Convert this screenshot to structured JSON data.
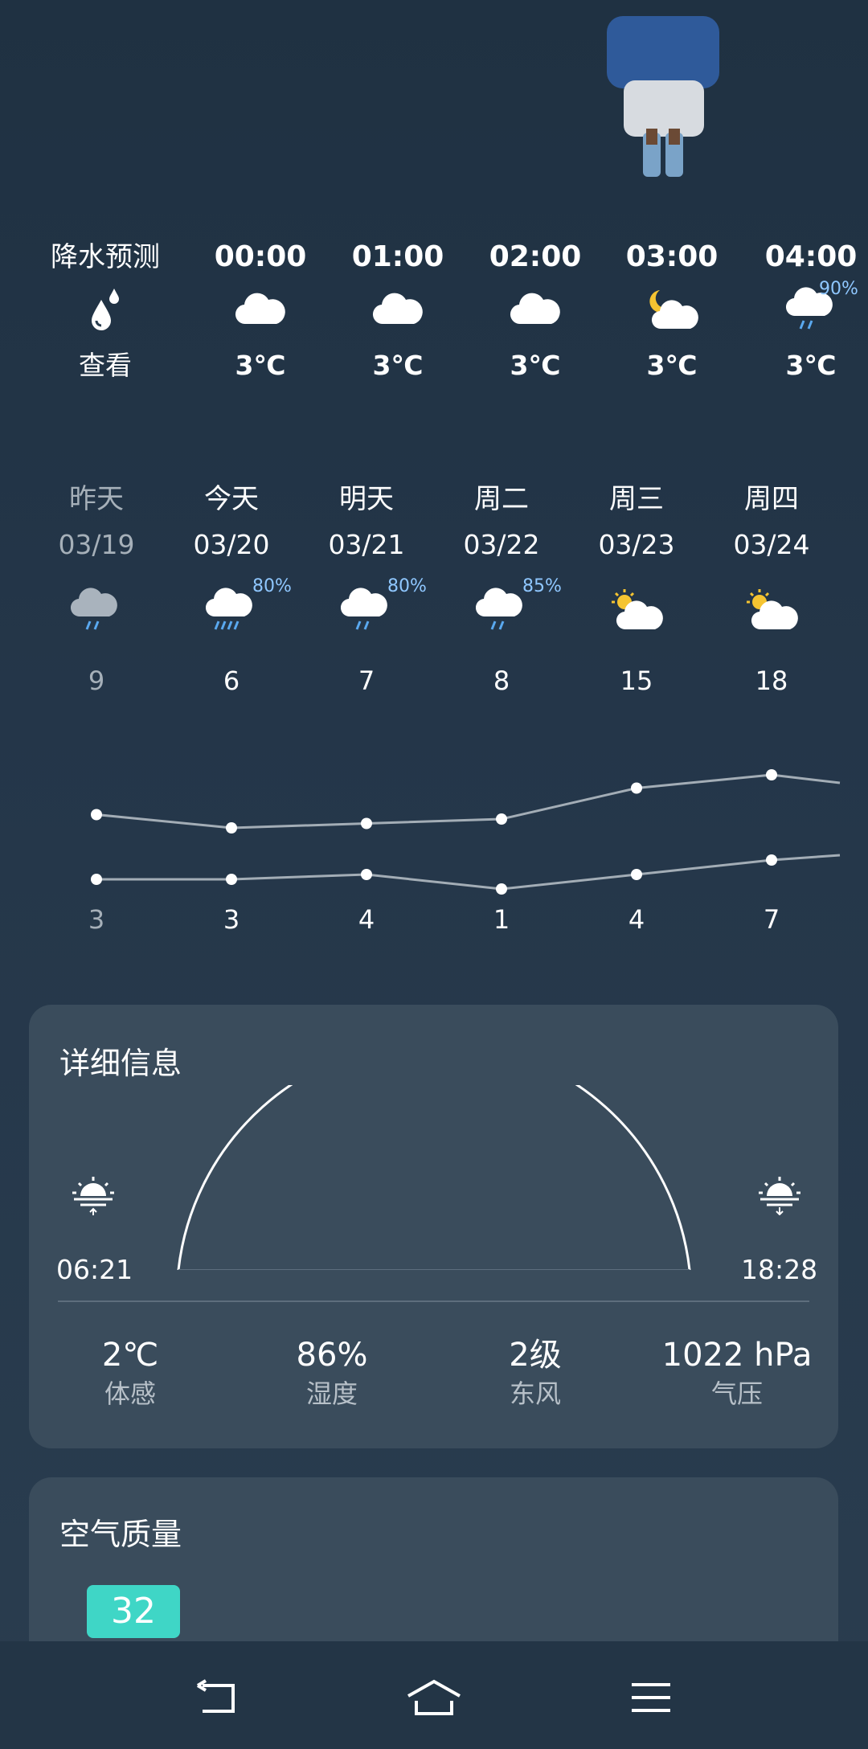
{
  "hourly": {
    "label": "降水预测",
    "check": "查看",
    "items": [
      {
        "time": "00:00",
        "temp": "3℃",
        "icon": "cloudy-icon",
        "pct": ""
      },
      {
        "time": "01:00",
        "temp": "3℃",
        "icon": "cloudy-icon",
        "pct": ""
      },
      {
        "time": "02:00",
        "temp": "3℃",
        "icon": "cloudy-icon",
        "pct": ""
      },
      {
        "time": "03:00",
        "temp": "3℃",
        "icon": "cloudy-night-icon",
        "pct": ""
      },
      {
        "time": "04:00",
        "temp": "3℃",
        "icon": "light-rain-icon",
        "pct": "90%"
      }
    ]
  },
  "daily": [
    {
      "name": "昨天",
      "date": "03/19",
      "high": "9",
      "low": "3",
      "pct": "",
      "icon": "light-rain-icon"
    },
    {
      "name": "今天",
      "date": "03/20",
      "high": "6",
      "low": "3",
      "pct": "80%",
      "icon": "moderate-rain-icon"
    },
    {
      "name": "明天",
      "date": "03/21",
      "high": "7",
      "low": "4",
      "pct": "80%",
      "icon": "light-rain-icon"
    },
    {
      "name": "周二",
      "date": "03/22",
      "high": "8",
      "low": "1",
      "pct": "85%",
      "icon": "light-rain-icon"
    },
    {
      "name": "周三",
      "date": "03/23",
      "high": "15",
      "low": "4",
      "pct": "",
      "icon": "partly-sunny-icon"
    },
    {
      "name": "周四",
      "date": "03/24",
      "high": "18",
      "low": "7",
      "pct": "",
      "icon": "partly-sunny-icon"
    }
  ],
  "details": {
    "title": "详细信息",
    "sunrise": "06:21",
    "sunset": "18:28",
    "stats": [
      {
        "value": "2℃",
        "label": "体感"
      },
      {
        "value": "86%",
        "label": "湿度"
      },
      {
        "value": "2级",
        "label": "东风"
      },
      {
        "value": "1022 hPa",
        "label": "气压"
      }
    ]
  },
  "air": {
    "title": "空气质量",
    "aqi": "32",
    "aqi_color": "#3fd6c6"
  }
}
